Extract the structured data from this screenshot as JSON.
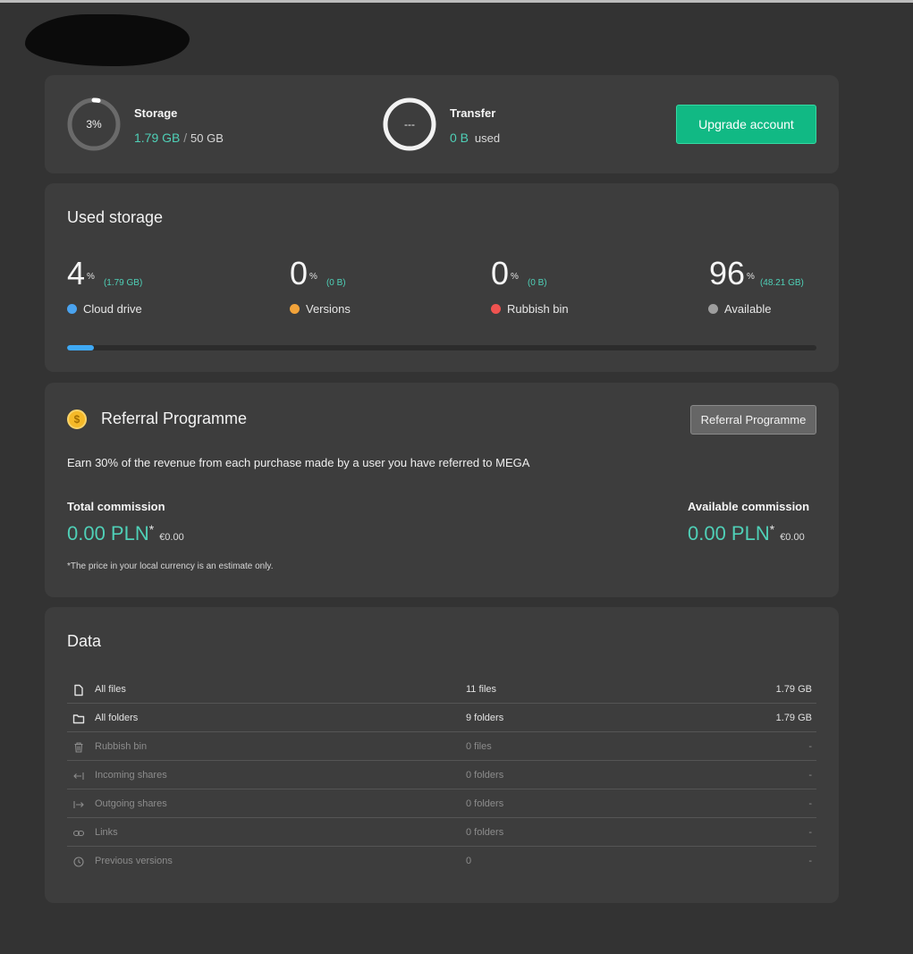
{
  "summary": {
    "storage_title": "Storage",
    "storage_percent_label": "3%",
    "storage_used": "1.79 GB",
    "storage_sep": "/",
    "storage_total": "50 GB",
    "storage_percent": 3,
    "transfer_title": "Transfer",
    "transfer_ring_label": "---",
    "transfer_used": "0 B",
    "transfer_used_suffix": "used",
    "upgrade_label": "Upgrade account"
  },
  "used_storage": {
    "title": "Used storage",
    "pct_symbol": "%",
    "items": [
      {
        "percent": "4",
        "size": "(1.79 GB)",
        "label": "Cloud drive",
        "color": "#4aa3ef"
      },
      {
        "percent": "0",
        "size": "(0 B)",
        "label": "Versions",
        "color": "#f2a33a"
      },
      {
        "percent": "0",
        "size": "(0 B)",
        "label": "Rubbish bin",
        "color": "#ef5350"
      },
      {
        "percent": "96",
        "size": "(48.21 GB)",
        "label": "Available",
        "color": "#9e9e9e"
      }
    ],
    "bar_fill_percent": 3.6
  },
  "referral": {
    "coin_icon_glyph": "$",
    "title": "Referral Programme",
    "button_label": "Referral Programme",
    "description": "Earn 30% of the revenue from each purchase made by a user you have referred to MEGA",
    "total_label": "Total commission",
    "total_value": "0.00 PLN",
    "total_star": "*",
    "total_eur": "€0.00",
    "available_label": "Available commission",
    "available_value": "0.00 PLN",
    "available_star": "*",
    "available_eur": "€0.00",
    "note": "*The price in your local currency is an estimate only."
  },
  "data": {
    "title": "Data",
    "rows": [
      {
        "icon": "file-icon",
        "name": "All files",
        "count": "11 files",
        "size": "1.79 GB",
        "active": true
      },
      {
        "icon": "folder-icon",
        "name": "All folders",
        "count": "9 folders",
        "size": "1.79 GB",
        "active": true
      },
      {
        "icon": "trash-icon",
        "name": "Rubbish bin",
        "count": "0 files",
        "size": "-",
        "active": false
      },
      {
        "icon": "incoming-shares-icon",
        "name": "Incoming shares",
        "count": "0 folders",
        "size": "-",
        "active": false
      },
      {
        "icon": "outgoing-shares-icon",
        "name": "Outgoing shares",
        "count": "0 folders",
        "size": "-",
        "active": false
      },
      {
        "icon": "link-icon",
        "name": "Links",
        "count": "0 folders",
        "size": "-",
        "active": false
      },
      {
        "icon": "history-icon",
        "name": "Previous versions",
        "count": "0",
        "size": "-",
        "active": false
      }
    ]
  }
}
